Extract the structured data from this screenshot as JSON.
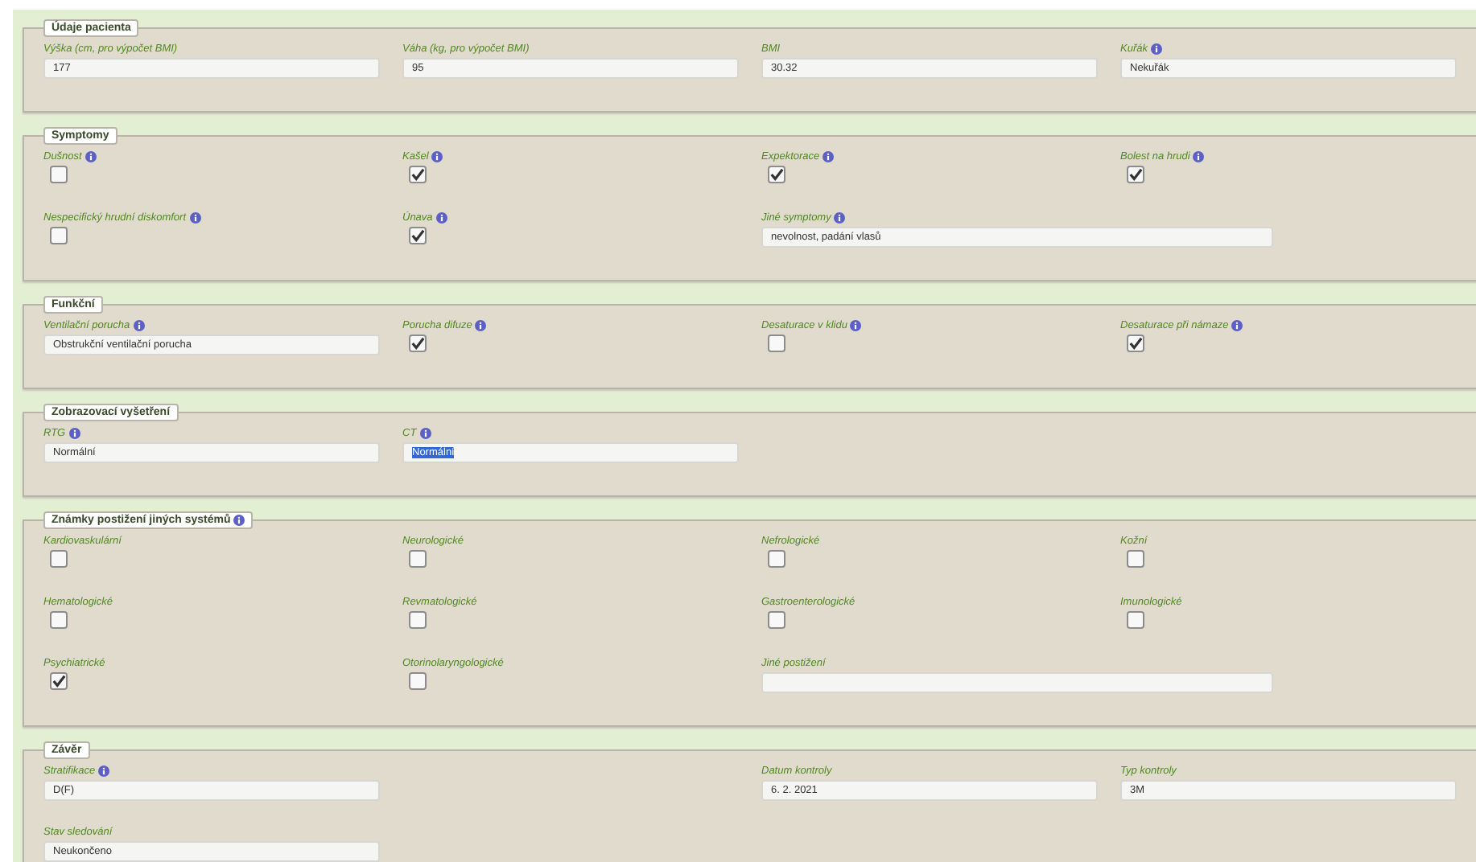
{
  "sections": [
    {
      "legend": "Údaje pacienta",
      "info": false,
      "rows": [
        [
          {
            "kind": "text",
            "label": "Výška (cm, pro výpočet BMI)",
            "info": false,
            "value": "177"
          },
          {
            "kind": "text",
            "label": "Váha (kg, pro výpočet BMI)",
            "info": false,
            "value": "95"
          },
          {
            "kind": "text",
            "label": "BMI",
            "info": false,
            "value": "30.32"
          },
          {
            "kind": "text",
            "label": "Kuřák",
            "info": true,
            "value": "Nekuřák"
          }
        ]
      ]
    },
    {
      "legend": "Symptomy",
      "info": false,
      "rows": [
        [
          {
            "kind": "checkbox",
            "label": "Dušnost",
            "info": true,
            "checked": false
          },
          {
            "kind": "checkbox",
            "label": "Kašel",
            "info": true,
            "checked": true
          },
          {
            "kind": "checkbox",
            "label": "Expektorace",
            "info": true,
            "checked": true
          },
          {
            "kind": "checkbox",
            "label": "Bolest na hrudi",
            "info": true,
            "checked": true
          }
        ],
        [
          {
            "kind": "checkbox",
            "label": "Nespecifický hrudní diskomfort",
            "info": true,
            "checked": false
          },
          {
            "kind": "checkbox",
            "label": "Únava",
            "info": true,
            "checked": true
          },
          {
            "kind": "wide",
            "label": "Jiné symptomy",
            "info": true,
            "value": "nevolnost, padání vlasů"
          }
        ]
      ]
    },
    {
      "legend": "Funkční",
      "info": false,
      "rows": [
        [
          {
            "kind": "text",
            "label": "Ventilační porucha",
            "info": true,
            "value": "Obstrukční ventilační porucha"
          },
          {
            "kind": "checkbox",
            "label": "Porucha difuze",
            "info": true,
            "checked": true
          },
          {
            "kind": "checkbox",
            "label": "Desaturace v klidu",
            "info": true,
            "checked": false
          },
          {
            "kind": "checkbox",
            "label": "Desaturace při námaze",
            "info": true,
            "checked": true
          }
        ]
      ]
    },
    {
      "legend": "Zobrazovací vyšetření",
      "info": false,
      "rows": [
        [
          {
            "kind": "text",
            "label": "RTG",
            "info": true,
            "value": "Normální",
            "selected": false
          },
          {
            "kind": "text",
            "label": "CT",
            "info": true,
            "value": "Normální",
            "selected": true
          }
        ]
      ]
    },
    {
      "legend": "Známky postižení jiných systémů",
      "info": true,
      "rows": [
        [
          {
            "kind": "checkbox",
            "label": "Kardiovaskulární",
            "info": false,
            "checked": false
          },
          {
            "kind": "checkbox",
            "label": "Neurologické",
            "info": false,
            "checked": false
          },
          {
            "kind": "checkbox",
            "label": "Nefrologické",
            "info": false,
            "checked": false
          },
          {
            "kind": "checkbox",
            "label": "Kožní",
            "info": false,
            "checked": false
          }
        ],
        [
          {
            "kind": "checkbox",
            "label": "Hematologické",
            "info": false,
            "checked": false
          },
          {
            "kind": "checkbox",
            "label": "Revmatologické",
            "info": false,
            "checked": false
          },
          {
            "kind": "checkbox",
            "label": "Gastroenterologické",
            "info": false,
            "checked": false
          },
          {
            "kind": "checkbox",
            "label": "Imunologické",
            "info": false,
            "checked": false
          }
        ],
        [
          {
            "kind": "checkbox",
            "label": "Psychiatrické",
            "info": false,
            "checked": true
          },
          {
            "kind": "checkbox",
            "label": "Otorinolaryngologické",
            "info": false,
            "checked": false
          },
          {
            "kind": "wide",
            "label": "Jiné postižení",
            "info": false
          }
        ]
      ]
    },
    {
      "legend": "Závěr",
      "info": false,
      "rows": [
        [
          {
            "kind": "text",
            "label": "Stratifikace",
            "info": true,
            "value": "D(F)"
          },
          null,
          {
            "kind": "text",
            "label": "Datum kontroly",
            "info": false,
            "value": "6. 2. 2021"
          },
          {
            "kind": "text",
            "label": "Typ kontroly",
            "info": false,
            "value": "3M"
          }
        ],
        [
          {
            "kind": "text",
            "label": "Stav sledování",
            "info": false,
            "value": "Neukončeno"
          }
        ]
      ]
    }
  ]
}
